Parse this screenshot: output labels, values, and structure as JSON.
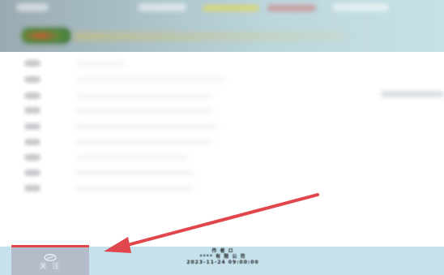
{
  "header": {
    "banner_text": ""
  },
  "list": {
    "items": [
      {
        "label": "────────",
        "icon": "list-icon"
      },
      {
        "label": "────────────────────────",
        "icon": "list-icon"
      },
      {
        "label": "──────────────────────",
        "icon": "list-icon"
      },
      {
        "label": "──────────────────────",
        "icon": "list-icon"
      },
      {
        "label": "───────────────────────",
        "icon": "list-icon"
      },
      {
        "label": "──────────────────────",
        "icon": "list-icon"
      },
      {
        "label": "──────────────────",
        "icon": "list-icon"
      },
      {
        "label": "───────────────────",
        "icon": "list-icon"
      },
      {
        "label": "───────────────────",
        "icon": "list-icon"
      }
    ]
  },
  "bottom_bar": {
    "follow_label": "关 注",
    "follow_icon": "eye-icon",
    "author": "作 者 ロ",
    "publisher": "**** 有 限 公 司",
    "datetime": "2023-11-24 09:00:00"
  },
  "colors": {
    "annotation_arrow": "#e0464b",
    "bottom_bar_bg": "#c5e2ec",
    "follow_button_bg": "#b5bcc9"
  }
}
